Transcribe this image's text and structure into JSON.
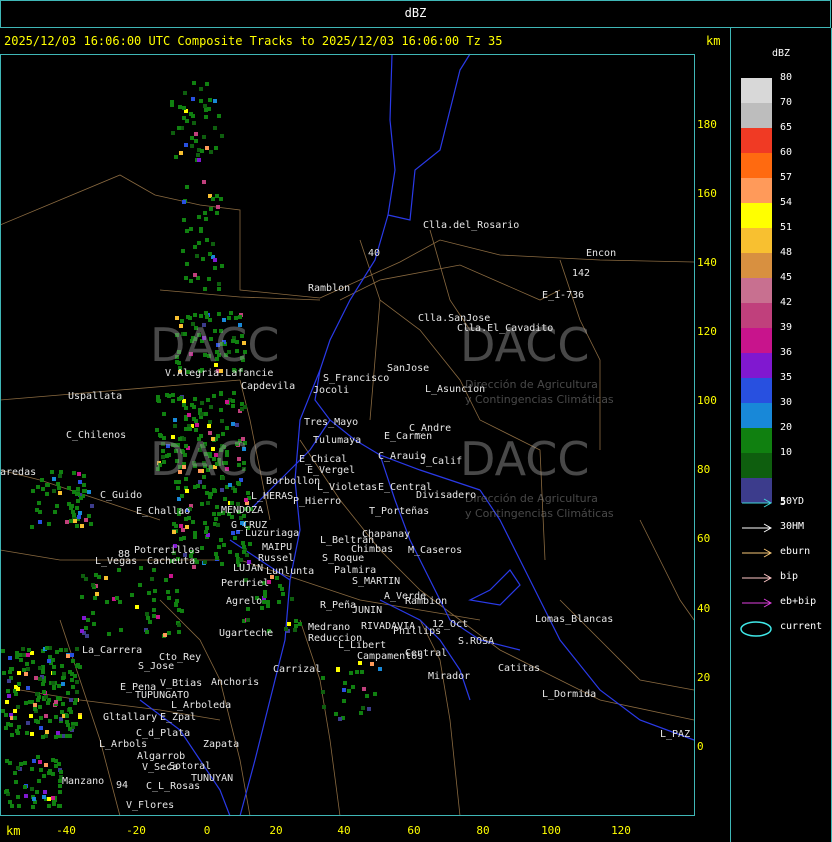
{
  "header": {
    "unit": "dBZ"
  },
  "title": "2025/12/03 16:06:00 UTC Composite Tracks to 2025/12/03 16:06:00 Tz 35",
  "axis": {
    "km_label": "km",
    "y_ticks": [
      "180",
      "160",
      "140",
      "120",
      "100",
      "80",
      "60",
      "40",
      "20",
      "0"
    ],
    "x_ticks": [
      "-40",
      "-20",
      "0",
      "20",
      "40",
      "60",
      "80",
      "100",
      "120"
    ]
  },
  "watermark": {
    "brand": "DACC",
    "line1": "Dirección de Agricultura",
    "line2": "y Contingencias Climáticas"
  },
  "places": [
    {
      "name": "Clla.del_Rosario"
    },
    {
      "name": "Encon"
    },
    {
      "name": "142"
    },
    {
      "name": "E_1-736"
    },
    {
      "name": "Ramblon"
    },
    {
      "name": "Clla.SanJose"
    },
    {
      "name": "Clla.El_Cavadito"
    },
    {
      "name": "40"
    },
    {
      "name": "V.Alegria.Lafancie"
    },
    {
      "name": "Capdevila"
    },
    {
      "name": "S_Francisco"
    },
    {
      "name": "Jocoli"
    },
    {
      "name": "SanJose"
    },
    {
      "name": "L_Asuncion"
    },
    {
      "name": "Uspallata"
    },
    {
      "name": "Tres_Mayo"
    },
    {
      "name": "Tulumaya"
    },
    {
      "name": "C_Andre"
    },
    {
      "name": "E_Carmen"
    },
    {
      "name": "C_Chilenos"
    },
    {
      "name": "E_Chical"
    },
    {
      "name": "E_Vergel"
    },
    {
      "name": "C_Arauio"
    },
    {
      "name": "J_Calif"
    },
    {
      "name": "aredas"
    },
    {
      "name": "Borbollon"
    },
    {
      "name": "L_Violetas"
    },
    {
      "name": "E_Central"
    },
    {
      "name": "Divisadero"
    },
    {
      "name": "C_Guido"
    },
    {
      "name": "L_HERAS"
    },
    {
      "name": "P_Hierro"
    },
    {
      "name": "E_Challao"
    },
    {
      "name": "MENDOZA"
    },
    {
      "name": "T_Porteñas"
    },
    {
      "name": "G_CRUZ"
    },
    {
      "name": "Luzuriaga"
    },
    {
      "name": "Chapanay"
    },
    {
      "name": "L_Beltran"
    },
    {
      "name": "Potrerillos"
    },
    {
      "name": "MAIPU"
    },
    {
      "name": "Chimbas"
    },
    {
      "name": "M_Caseros"
    },
    {
      "name": "L_Vegas"
    },
    {
      "name": "Cacheuta"
    },
    {
      "name": "Russel"
    },
    {
      "name": "S_Roque"
    },
    {
      "name": "LUJAN"
    },
    {
      "name": "Lunlunta"
    },
    {
      "name": "Palmira"
    },
    {
      "name": "Perdriel"
    },
    {
      "name": "S_MARTIN"
    },
    {
      "name": "Agrelo"
    },
    {
      "name": "A_Verde"
    },
    {
      "name": "R_Peña"
    },
    {
      "name": "JUNIN"
    },
    {
      "name": "Rambion"
    },
    {
      "name": "Lomas_Blancas"
    },
    {
      "name": "12_Oct"
    },
    {
      "name": "Ugarteche"
    },
    {
      "name": "Medrano"
    },
    {
      "name": "RIVADAVIA"
    },
    {
      "name": "Phillips"
    },
    {
      "name": "Reduccion"
    },
    {
      "name": "S.ROSA"
    },
    {
      "name": "L_Libert"
    },
    {
      "name": "Central"
    },
    {
      "name": "Campamentos"
    },
    {
      "name": "La_Carrera"
    },
    {
      "name": "Cto_Rey"
    },
    {
      "name": "S_Jose"
    },
    {
      "name": "Carrizal"
    },
    {
      "name": "Catitas"
    },
    {
      "name": "Mirador"
    },
    {
      "name": "V_Btias"
    },
    {
      "name": "Anchoris"
    },
    {
      "name": "E_Pena"
    },
    {
      "name": "TUPUNGATO"
    },
    {
      "name": "L_Dormida"
    },
    {
      "name": "L_Arboleda"
    },
    {
      "name": "Gltallary"
    },
    {
      "name": "E_Zpal"
    },
    {
      "name": "L_PAZ"
    },
    {
      "name": "C_d_Plata"
    },
    {
      "name": "L_Arbols"
    },
    {
      "name": "Zapata"
    },
    {
      "name": "Algarrob"
    },
    {
      "name": "Sotoral"
    },
    {
      "name": "V_Seca"
    },
    {
      "name": "TUNUYAN"
    },
    {
      "name": "Manzano"
    },
    {
      "name": "94"
    },
    {
      "name": "C_L_Rosas"
    },
    {
      "name": "V_Flores"
    },
    {
      "name": "88"
    }
  ],
  "legend": {
    "title": "dBZ",
    "scale": [
      {
        "value": "80",
        "color": "#d8d8d8"
      },
      {
        "value": "70",
        "color": "#bdbdbd"
      },
      {
        "value": "65",
        "color": "#f03a24"
      },
      {
        "value": "60",
        "color": "#ff6a10"
      },
      {
        "value": "57",
        "color": "#ff9a5a"
      },
      {
        "value": "54",
        "color": "#ffff00"
      },
      {
        "value": "51",
        "color": "#f8c030"
      },
      {
        "value": "48",
        "color": "#d89040"
      },
      {
        "value": "45",
        "color": "#c87090"
      },
      {
        "value": "42",
        "color": "#c0407c"
      },
      {
        "value": "39",
        "color": "#c8148c"
      },
      {
        "value": "36",
        "color": "#8018d0"
      },
      {
        "value": "35",
        "color": "#2850e0"
      },
      {
        "value": "30",
        "color": "#1888d8"
      },
      {
        "value": "20",
        "color": "#108010"
      },
      {
        "value": "10",
        "color": "#0e5e0e"
      },
      {
        "value": "5",
        "color": "#3c3c8c"
      }
    ],
    "tracks": [
      {
        "label": "50YD",
        "color": "#40d8d8"
      },
      {
        "label": "30HM",
        "color": "#ffffff"
      },
      {
        "label": "eburn",
        "color": "#f8c878"
      },
      {
        "label": "bip",
        "color": "#ffc8c8"
      },
      {
        "label": "eb+bip",
        "color": "#e040e0"
      },
      {
        "label": "current",
        "color": "#40e8e8"
      }
    ]
  }
}
